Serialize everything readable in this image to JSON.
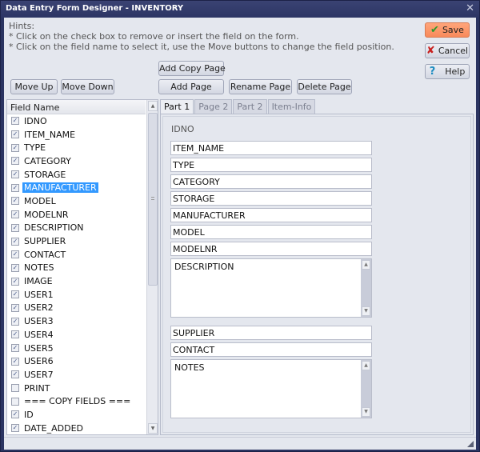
{
  "window": {
    "title": "Data Entry Form Designer - INVENTORY",
    "close_glyph": "✕"
  },
  "hints": {
    "title": "Hints:",
    "lines": [
      "* Click on the check box to remove or insert the field on the form.",
      "* Click on the field name to select it, use the Move buttons to change the field position."
    ]
  },
  "buttons": {
    "save": "Save",
    "cancel": "Cancel",
    "help": "Help",
    "add_copy_page": "Add Copy Page",
    "add_page": "Add Page",
    "rename_page": "Rename Page",
    "delete_page": "Delete Page",
    "move_up": "Move Up",
    "move_down": "Move Down"
  },
  "icons": {
    "save": "✔",
    "cancel": "✘",
    "help": "?",
    "check": "✓",
    "scroll_up": "▲",
    "scroll_down": "▼"
  },
  "field_list": {
    "header": "Field Name",
    "items": [
      {
        "name": "IDNO",
        "checked": true,
        "selected": false
      },
      {
        "name": "ITEM_NAME",
        "checked": true,
        "selected": false
      },
      {
        "name": "TYPE",
        "checked": true,
        "selected": false
      },
      {
        "name": "CATEGORY",
        "checked": true,
        "selected": false
      },
      {
        "name": "STORAGE",
        "checked": true,
        "selected": false
      },
      {
        "name": "MANUFACTURER",
        "checked": true,
        "selected": true
      },
      {
        "name": "MODEL",
        "checked": true,
        "selected": false
      },
      {
        "name": "MODELNR",
        "checked": true,
        "selected": false
      },
      {
        "name": "DESCRIPTION",
        "checked": true,
        "selected": false
      },
      {
        "name": "SUPPLIER",
        "checked": true,
        "selected": false
      },
      {
        "name": "CONTACT",
        "checked": true,
        "selected": false
      },
      {
        "name": "NOTES",
        "checked": true,
        "selected": false
      },
      {
        "name": "IMAGE",
        "checked": true,
        "selected": false
      },
      {
        "name": "USER1",
        "checked": true,
        "selected": false
      },
      {
        "name": "USER2",
        "checked": true,
        "selected": false
      },
      {
        "name": "USER3",
        "checked": true,
        "selected": false
      },
      {
        "name": "USER4",
        "checked": true,
        "selected": false
      },
      {
        "name": "USER5",
        "checked": true,
        "selected": false
      },
      {
        "name": "USER6",
        "checked": true,
        "selected": false
      },
      {
        "name": "USER7",
        "checked": true,
        "selected": false
      },
      {
        "name": "PRINT",
        "checked": false,
        "selected": false
      },
      {
        "name": "=== COPY FIELDS ===",
        "checked": false,
        "selected": false
      },
      {
        "name": "ID",
        "checked": true,
        "selected": false
      },
      {
        "name": "DATE_ADDED",
        "checked": true,
        "selected": false
      }
    ]
  },
  "tabs": [
    {
      "label": "Part 1",
      "active": true
    },
    {
      "label": "Page 2",
      "active": false
    },
    {
      "label": "Part 2",
      "active": false
    },
    {
      "label": "Item-Info",
      "active": false
    }
  ],
  "form": {
    "label_field": "IDNO",
    "fields": [
      {
        "name": "ITEM_NAME",
        "kind": "text"
      },
      {
        "name": "TYPE",
        "kind": "text"
      },
      {
        "name": "CATEGORY",
        "kind": "text"
      },
      {
        "name": "STORAGE",
        "kind": "text"
      },
      {
        "name": "MANUFACTURER",
        "kind": "text"
      },
      {
        "name": "MODEL",
        "kind": "text"
      },
      {
        "name": "MODELNR",
        "kind": "text"
      },
      {
        "name": "DESCRIPTION",
        "kind": "memo"
      },
      {
        "name": "SUPPLIER",
        "kind": "text"
      },
      {
        "name": "CONTACT",
        "kind": "text"
      },
      {
        "name": "NOTES",
        "kind": "memo"
      }
    ]
  },
  "colors": {
    "selection": "#3399ff",
    "save_button": "#f88a5b",
    "titlebar": "#2c3564"
  }
}
